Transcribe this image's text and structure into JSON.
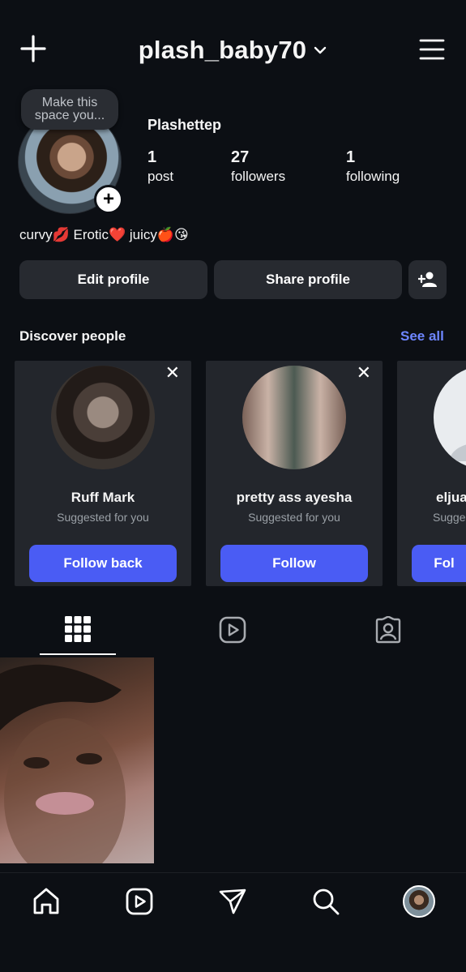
{
  "header": {
    "username": "plash_baby70",
    "icons": {
      "create": "plus-icon",
      "dropdown": "chevron-down-icon",
      "menu": "hamburger-menu-icon"
    }
  },
  "profile": {
    "note_bubble": {
      "line1": "Make this",
      "line2": "space you..."
    },
    "display_name": "Plashettep",
    "stats": [
      {
        "count": "1",
        "label": "post"
      },
      {
        "count": "27",
        "label": "followers"
      },
      {
        "count": "1",
        "label": "following"
      }
    ],
    "bio": "curvy💋 Erotic❤️ juicy🍎😘"
  },
  "actions": {
    "edit_profile": "Edit profile",
    "share_profile": "Share profile",
    "add_person_icon": "add-person-icon"
  },
  "discover": {
    "title": "Discover people",
    "see_all": "See all",
    "cards": [
      {
        "name": "Ruff Mark",
        "subtitle": "Suggested for you",
        "button": "Follow back"
      },
      {
        "name": "pretty ass ayesha",
        "subtitle": "Suggested for you",
        "button": "Follow"
      },
      {
        "name": "eljua",
        "subtitle": "Sugge",
        "button": "Fol"
      }
    ]
  },
  "tabs": [
    {
      "icon": "grid-icon",
      "active": true
    },
    {
      "icon": "reels-icon",
      "active": false
    },
    {
      "icon": "tagged-person-icon",
      "active": false
    }
  ],
  "bottom_nav": [
    {
      "icon": "home-icon"
    },
    {
      "icon": "reels-icon"
    },
    {
      "icon": "send-icon"
    },
    {
      "icon": "search-icon"
    },
    {
      "icon": "profile-avatar"
    }
  ],
  "colors": {
    "background": "#0c0f14",
    "card": "#23262c",
    "button": "#272a30",
    "accent": "#4a5cf4",
    "link": "#6e86ff"
  }
}
